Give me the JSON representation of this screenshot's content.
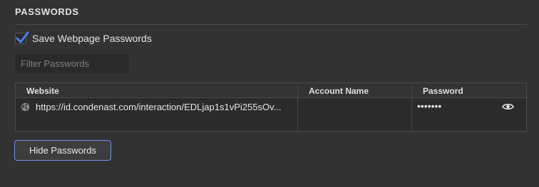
{
  "section": {
    "title": "PASSWORDS"
  },
  "save_passwords": {
    "label": "Save Webpage Passwords",
    "checked": true
  },
  "filter": {
    "placeholder": "Filter Passwords",
    "value": ""
  },
  "table": {
    "columns": [
      "Website",
      "Account Name",
      "Password"
    ],
    "rows": [
      {
        "icon": "globe-icon",
        "website": "https://id.condenast.com/interaction/EDLjap1s1vPi255sOv...",
        "account_name": "",
        "password_masked": "•••••••",
        "reveal_icon": "eye-icon"
      }
    ]
  },
  "hide_button": {
    "label": "Hide Passwords"
  },
  "colors": {
    "background": "#323232",
    "checkbox_accent": "#4a7cf0",
    "focus_ring": "#7b8fe6"
  }
}
